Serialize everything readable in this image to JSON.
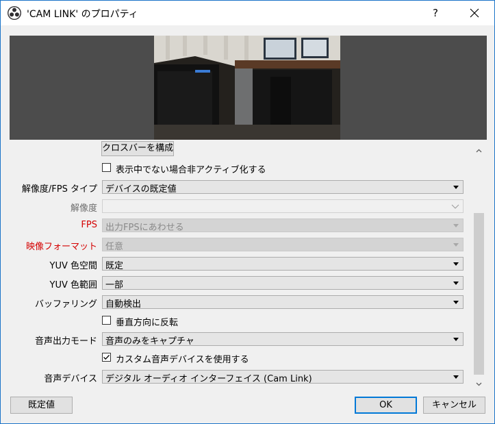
{
  "window": {
    "title": "'CAM LINK' のプロパティ",
    "help_label": "?"
  },
  "properties": {
    "crossbar_button": "クロスバーを構成",
    "deactivate_checkbox": {
      "label": "表示中でない場合非アクティブ化する",
      "checked": false
    },
    "resolution_fps_type": {
      "label": "解像度/FPS タイプ",
      "value": "デバイスの既定値"
    },
    "resolution": {
      "label": "解像度",
      "value": ""
    },
    "fps": {
      "label": "FPS",
      "value": "出力FPSにあわせる"
    },
    "video_format": {
      "label": "映像フォーマット",
      "value": "任意"
    },
    "yuv_color_space": {
      "label": "YUV 色空間",
      "value": "既定"
    },
    "yuv_color_range": {
      "label": "YUV 色範囲",
      "value": "一部"
    },
    "buffering": {
      "label": "バッファリング",
      "value": "自動検出"
    },
    "flip_vertical_checkbox": {
      "label": "垂直方向に反転",
      "checked": false
    },
    "audio_output_mode": {
      "label": "音声出力モード",
      "value": "音声のみをキャプチャ"
    },
    "custom_audio_checkbox": {
      "label": "カスタム音声デバイスを使用する",
      "checked": true
    },
    "audio_device": {
      "label": "音声デバイス",
      "value": "デジタル オーディオ インターフェイス (Cam Link)"
    }
  },
  "footer": {
    "defaults_button": "既定値",
    "ok_button": "OK",
    "cancel_button": "キャンセル"
  },
  "colors": {
    "accent": "#0078d7",
    "required_label": "#d40000",
    "preview_bg": "#4c4c4c"
  }
}
